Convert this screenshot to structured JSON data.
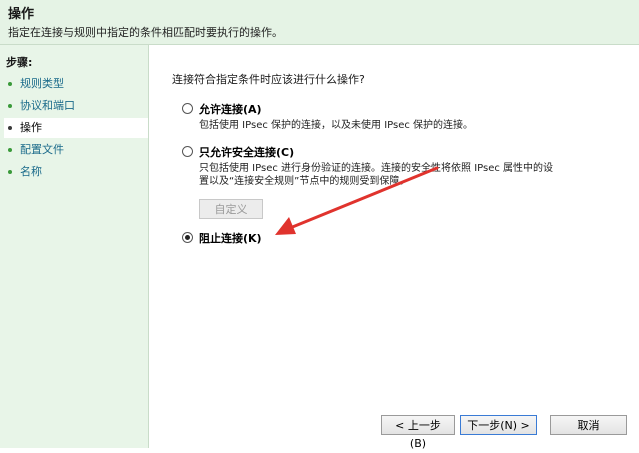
{
  "header": {
    "title": "操作",
    "description": "指定在连接与规则中指定的条件相匹配时要执行的操作。"
  },
  "sidebar": {
    "steps_title": "步骤:",
    "items": [
      {
        "label": "规则类型"
      },
      {
        "label": "协议和端口"
      },
      {
        "label": "操作"
      },
      {
        "label": "配置文件"
      },
      {
        "label": "名称"
      }
    ]
  },
  "main": {
    "question": "连接符合指定条件时应该进行什么操作?",
    "options": [
      {
        "label": "允许连接(A)",
        "description": "包括使用 IPsec 保护的连接，以及未使用 IPsec 保护的连接。",
        "selected": false
      },
      {
        "label": "只允许安全连接(C)",
        "description_line1": "只包括使用 IPsec 进行身份验证的连接。连接的安全性将依照 IPsec 属性中的设",
        "description_line2": "置以及“连接安全规则”节点中的规则受到保障。",
        "selected": false
      },
      {
        "label": "阻止连接(K)",
        "selected": true
      }
    ],
    "customize_button": "自定义"
  },
  "footer": {
    "back_button": "< 上一步(B)",
    "next_button": "下一步(N) >",
    "cancel_button": "取消"
  },
  "colors": {
    "sidebar_bg": "#e8f5e8",
    "header_bg": "#e5f3e5",
    "annotation_arrow": "#e0332d"
  }
}
